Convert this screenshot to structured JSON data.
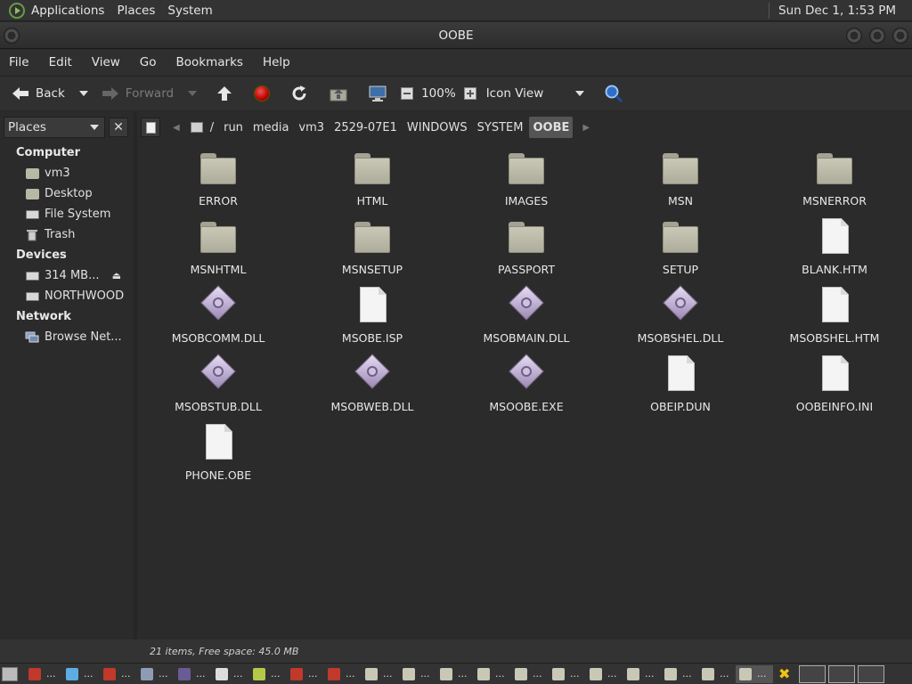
{
  "top_panel": {
    "menus": [
      "Applications",
      "Places",
      "System"
    ],
    "clock": "Sun Dec 1,  1:53 PM"
  },
  "window": {
    "title": "OOBE"
  },
  "menubar": [
    "File",
    "Edit",
    "View",
    "Go",
    "Bookmarks",
    "Help"
  ],
  "toolbar": {
    "back_label": "Back",
    "forward_label": "Forward",
    "zoom_value": "100%",
    "view_mode": "Icon View"
  },
  "sidebar": {
    "combo_label": "Places",
    "sections": [
      {
        "title": "Computer",
        "items": [
          {
            "label": "vm3",
            "icon": "home-folder-icon"
          },
          {
            "label": "Desktop",
            "icon": "desktop-folder-icon"
          },
          {
            "label": "File System",
            "icon": "drive-icon"
          },
          {
            "label": "Trash",
            "icon": "trash-icon"
          }
        ]
      },
      {
        "title": "Devices",
        "items": [
          {
            "label": "314 MB...",
            "icon": "drive-icon",
            "eject": true
          },
          {
            "label": "NORTHWOOD",
            "icon": "drive-icon"
          }
        ]
      },
      {
        "title": "Network",
        "items": [
          {
            "label": "Browse Net...",
            "icon": "network-icon"
          }
        ]
      }
    ]
  },
  "pathbar": {
    "crumbs": [
      "/",
      "run",
      "media",
      "vm3",
      "2529-07E1",
      "WINDOWS",
      "SYSTEM",
      "OOBE"
    ],
    "active_index": 7
  },
  "files": [
    {
      "name": "ERROR",
      "type": "folder"
    },
    {
      "name": "HTML",
      "type": "folder"
    },
    {
      "name": "IMAGES",
      "type": "folder"
    },
    {
      "name": "MSN",
      "type": "folder"
    },
    {
      "name": "MSNERROR",
      "type": "folder"
    },
    {
      "name": "MSNHTML",
      "type": "folder"
    },
    {
      "name": "MSNSETUP",
      "type": "folder"
    },
    {
      "name": "PASSPORT",
      "type": "folder"
    },
    {
      "name": "SETUP",
      "type": "folder"
    },
    {
      "name": "BLANK.HTM",
      "type": "document"
    },
    {
      "name": "MSOBCOMM.DLL",
      "type": "executable"
    },
    {
      "name": "MSOBE.ISP",
      "type": "document"
    },
    {
      "name": "MSOBMAIN.DLL",
      "type": "executable"
    },
    {
      "name": "MSOBSHEL.DLL",
      "type": "executable"
    },
    {
      "name": "MSOBSHEL.HTM",
      "type": "document"
    },
    {
      "name": "MSOBSTUB.DLL",
      "type": "executable"
    },
    {
      "name": "MSOBWEB.DLL",
      "type": "executable"
    },
    {
      "name": "MSOOBE.EXE",
      "type": "executable"
    },
    {
      "name": "OBEIP.DUN",
      "type": "document"
    },
    {
      "name": "OOBEINFO.INI",
      "type": "document"
    },
    {
      "name": "PHONE.OBE",
      "type": "document"
    }
  ],
  "status": "21 items, Free space: 45.0 MB",
  "taskbar": {
    "tasks": [
      "...",
      "...",
      "...",
      "...",
      "...",
      "...",
      "...",
      "...",
      "...",
      "...",
      "...",
      "...",
      "...",
      "...",
      "...",
      "...",
      "...",
      "...",
      "...",
      "..."
    ],
    "active_task_index": 19
  }
}
